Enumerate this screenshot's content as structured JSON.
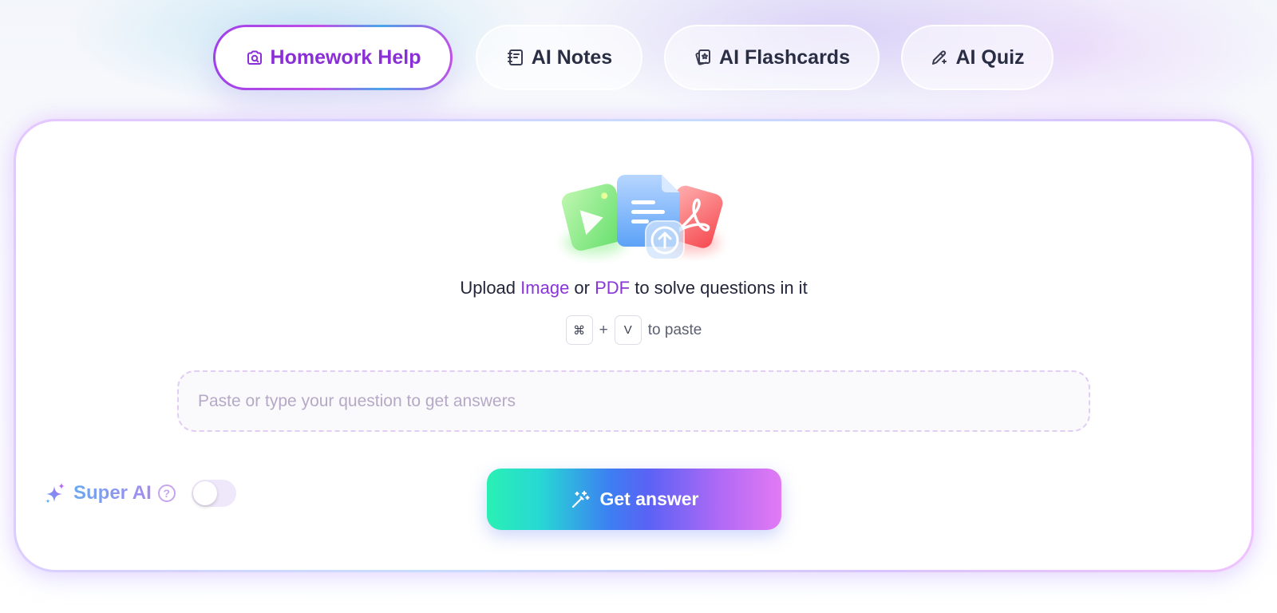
{
  "tabs": [
    {
      "label": "Homework Help",
      "icon": "camera-search-icon",
      "active": true
    },
    {
      "label": "AI Notes",
      "icon": "notebook-icon",
      "active": false
    },
    {
      "label": "AI Flashcards",
      "icon": "flashcard-icon",
      "active": false
    },
    {
      "label": "AI Quiz",
      "icon": "pencil-sparkle-icon",
      "active": false
    }
  ],
  "upload": {
    "prefix": "Upload ",
    "image_link": "Image",
    "middle": " or ",
    "pdf_link": "PDF",
    "suffix": " to solve questions in it"
  },
  "paste_hint": {
    "key1": "⌘",
    "plus": "+",
    "key2": "V",
    "text": "to paste"
  },
  "question_input": {
    "placeholder": "Paste or type your question to get answers",
    "value": ""
  },
  "super_ai": {
    "label": "Super AI",
    "help": "?",
    "enabled": false
  },
  "get_answer": {
    "label": "Get answer"
  },
  "colors": {
    "accent_purple": "#8a35d8",
    "text_dark": "#23263a",
    "button_gradient_start": "#2af0b4",
    "button_gradient_mid": "#3d7ef2",
    "button_gradient_end": "#e27af4"
  }
}
